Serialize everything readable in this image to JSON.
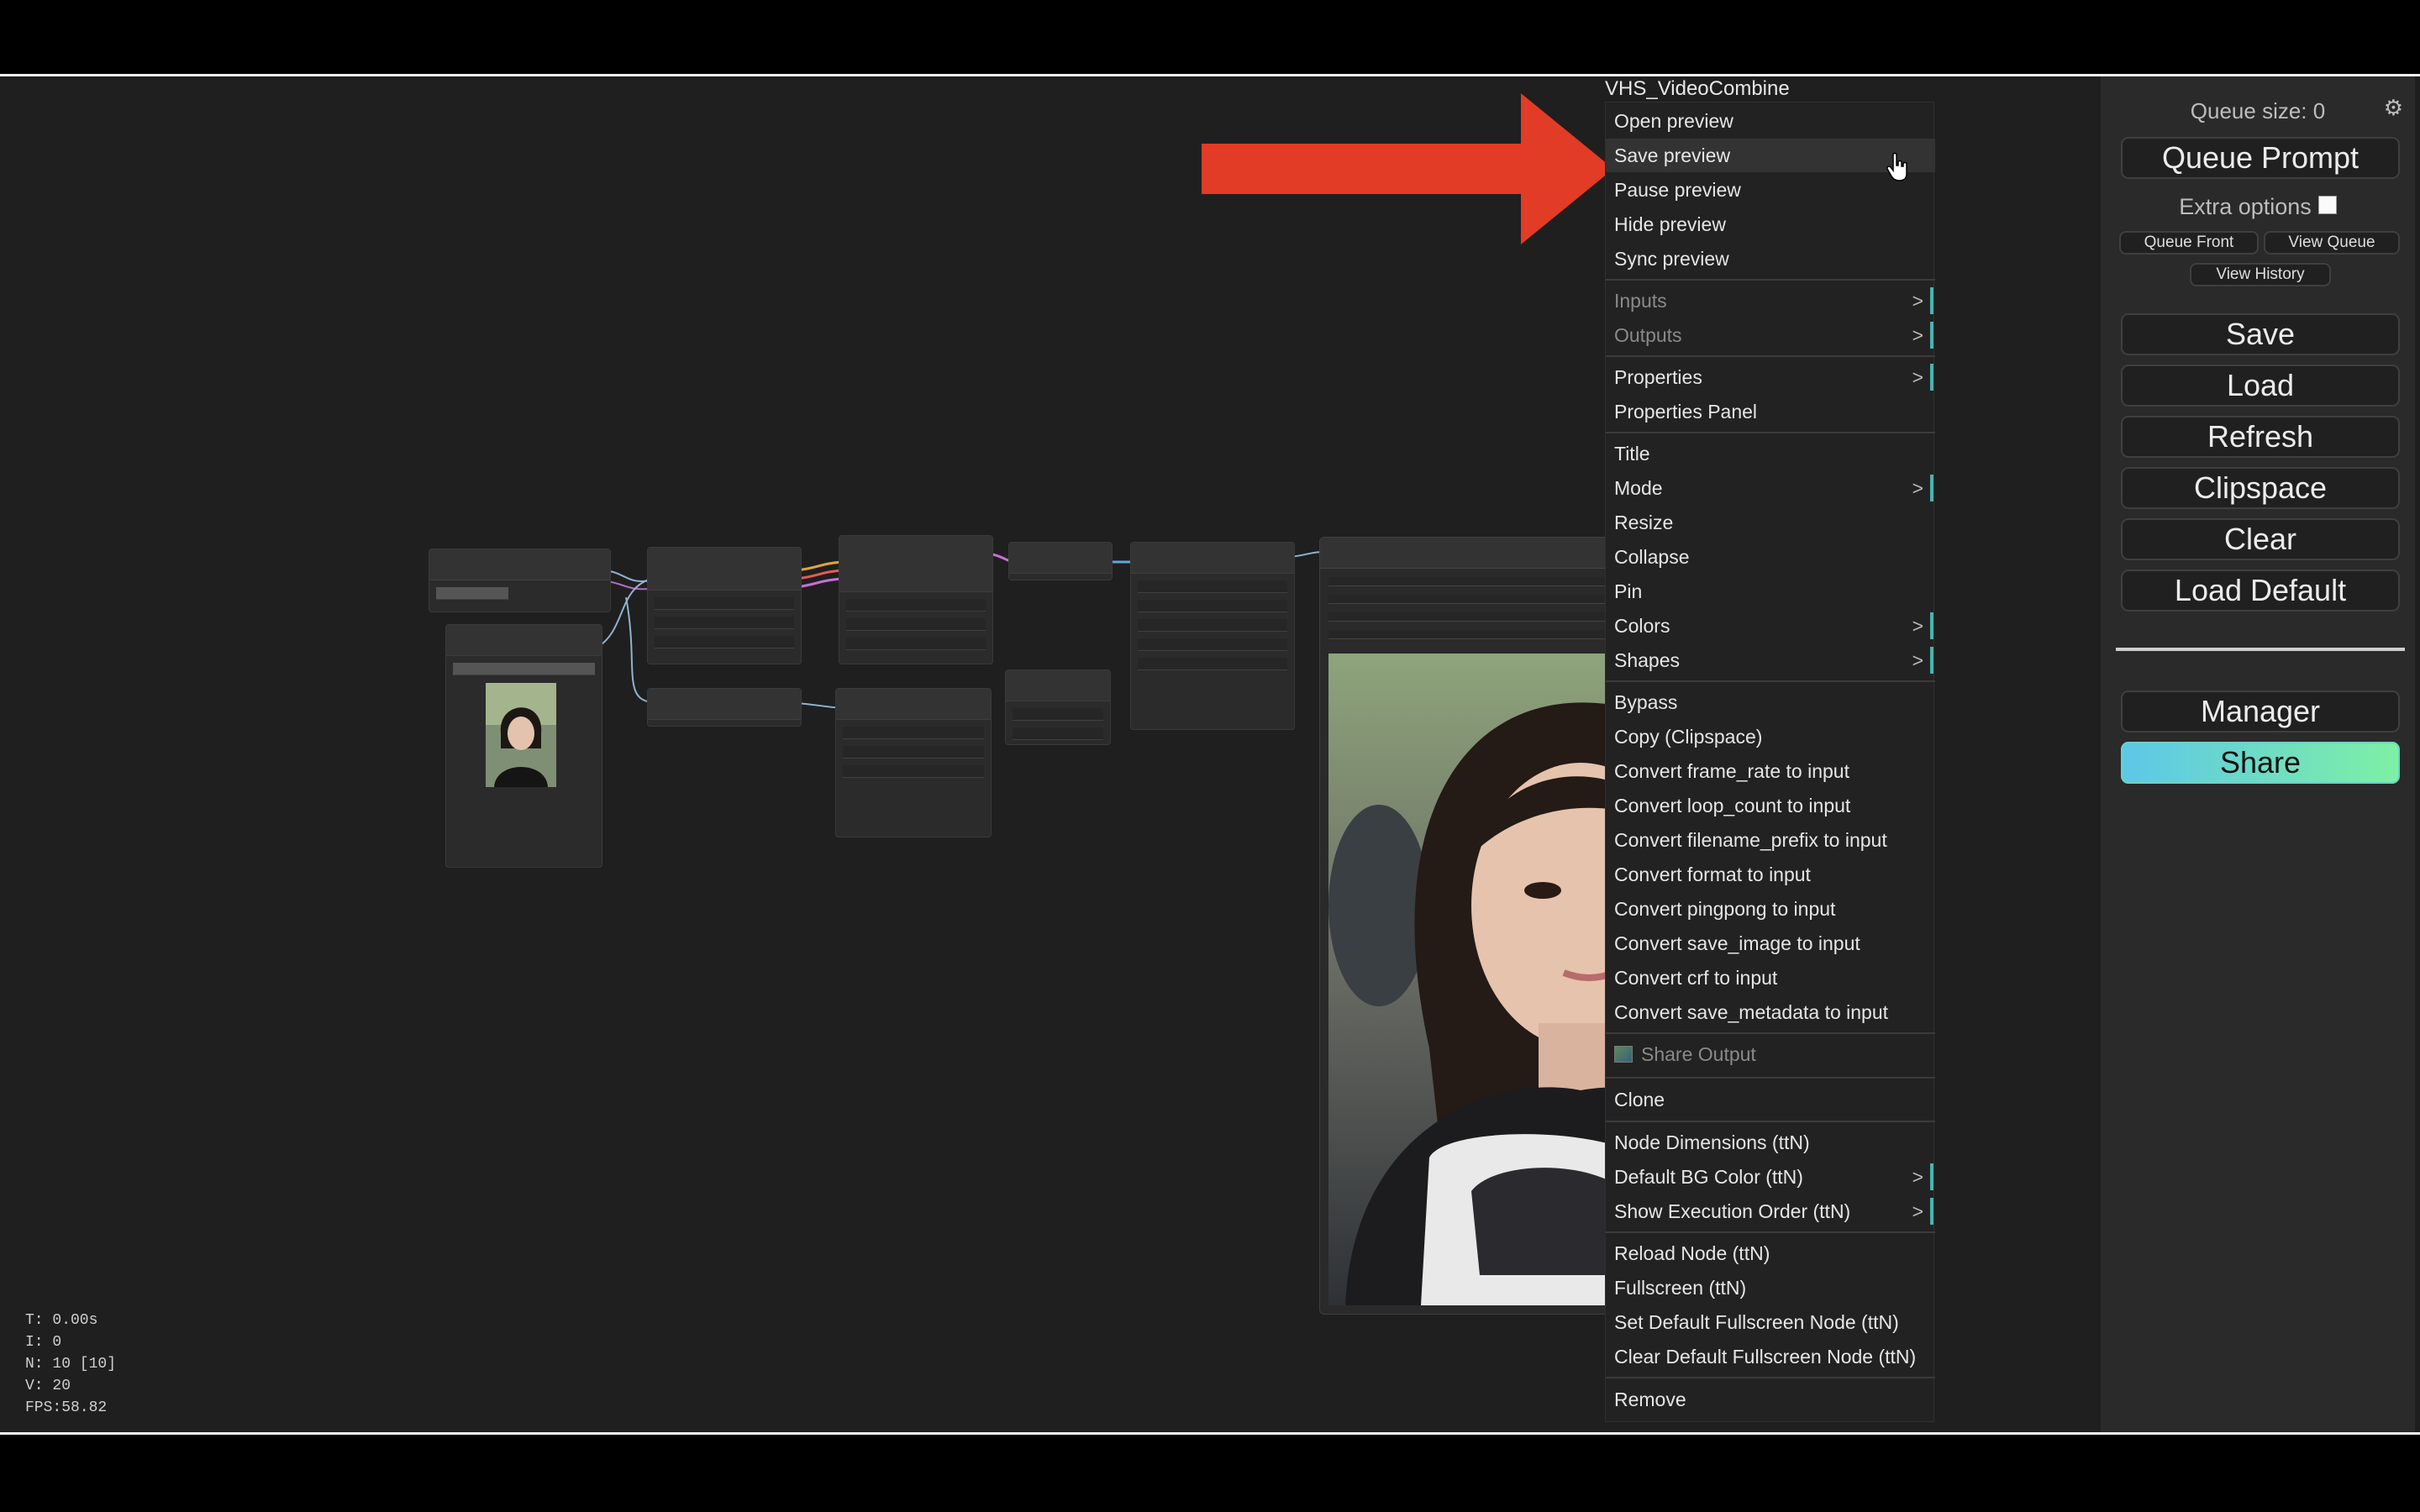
{
  "menu": {
    "title": "VHS_VideoCombine",
    "items": [
      {
        "label": "Open preview"
      },
      {
        "label": "Save preview"
      },
      {
        "label": "Pause preview"
      },
      {
        "label": "Hide preview"
      },
      {
        "label": "Sync preview"
      },
      {
        "label": "Inputs",
        "sub": ">"
      },
      {
        "label": "Outputs",
        "sub": ">"
      },
      {
        "label": "Properties",
        "sub": ">"
      },
      {
        "label": "Properties Panel"
      },
      {
        "label": "Title"
      },
      {
        "label": "Mode",
        "sub": ">"
      },
      {
        "label": "Resize"
      },
      {
        "label": "Collapse"
      },
      {
        "label": "Pin"
      },
      {
        "label": "Colors",
        "sub": ">"
      },
      {
        "label": "Shapes",
        "sub": ">"
      },
      {
        "label": "Bypass"
      },
      {
        "label": "Copy (Clipspace)"
      },
      {
        "label": "Convert frame_rate to input"
      },
      {
        "label": "Convert loop_count to input"
      },
      {
        "label": "Convert filename_prefix to input"
      },
      {
        "label": "Convert format to input"
      },
      {
        "label": "Convert pingpong to input"
      },
      {
        "label": "Convert save_image to input"
      },
      {
        "label": "Convert crf to input"
      },
      {
        "label": "Convert save_metadata to input"
      },
      {
        "label": "Share Output"
      },
      {
        "label": "Clone"
      },
      {
        "label": "Node Dimensions (ttN)"
      },
      {
        "label": "Default BG Color (ttN)",
        "sub": ">"
      },
      {
        "label": "Show Execution Order (ttN)",
        "sub": ">"
      },
      {
        "label": "Reload Node (ttN)"
      },
      {
        "label": "Fullscreen (ttN)"
      },
      {
        "label": "Set Default Fullscreen Node (ttN)"
      },
      {
        "label": "Clear Default Fullscreen Node (ttN)"
      },
      {
        "label": "Remove"
      }
    ]
  },
  "panel": {
    "queue_size": "Queue size: 0",
    "queue_prompt": "Queue Prompt",
    "extra_options": "Extra options",
    "queue_front": "Queue Front",
    "view_queue": "View Queue",
    "view_history": "View History",
    "save": "Save",
    "load": "Load",
    "refresh": "Refresh",
    "clipspace": "Clipspace",
    "clear": "Clear",
    "load_default": "Load Default",
    "manager": "Manager",
    "share": "Share",
    "share_gradient": [
      "#5dc7e8",
      "#7ef0a4"
    ]
  },
  "stats": {
    "t": "T: 0.00s",
    "i": "I: 0",
    "n": "N: 10 [10]",
    "v": "V: 20",
    "fps": "FPS:58.82"
  },
  "colors": {
    "annotation_arrow": "#e23b26",
    "menu_submenu_bar": "#49b3b0"
  }
}
